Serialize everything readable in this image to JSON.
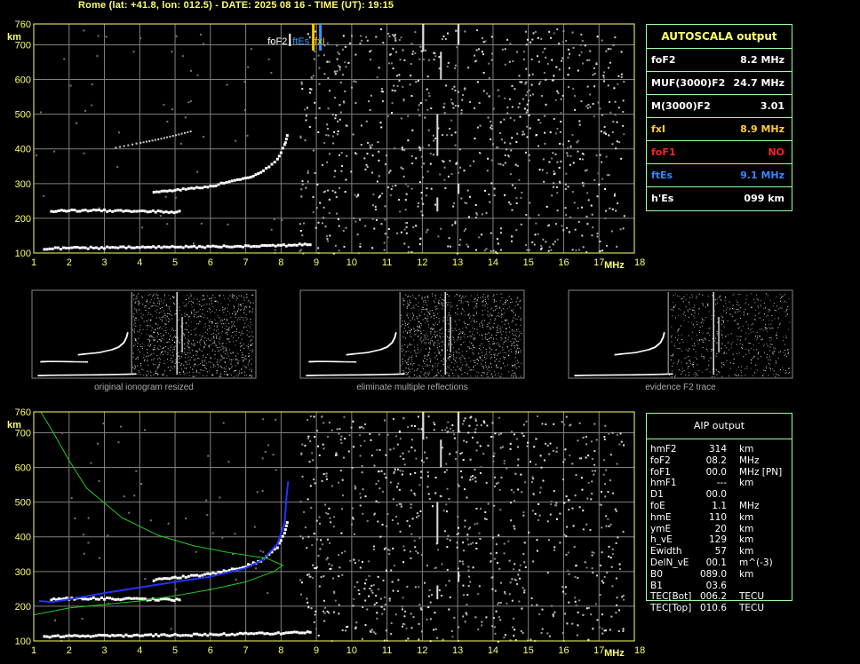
{
  "header": {
    "title": "Rome (lat: +41.8, lon: 012.5) - DATE: 2025 08 16 - TIME (UT): 19:15"
  },
  "colors": {
    "grid": "#808080",
    "axis_text": "#ffff66",
    "trace": "#ffffff",
    "frame": "#99ff99",
    "green_curve": "#22cc22",
    "blue_profile": "#2233ff",
    "fxi_marker": "#ffcc00",
    "ftes_marker": "#3399ff",
    "fof1_red": "#ff2222"
  },
  "autoscala": {
    "title": "AUTOSCALA output",
    "rows": [
      {
        "label": "foF2",
        "value": "8.2 MHz",
        "color": "#ffffff"
      },
      {
        "label": "MUF(3000)F2",
        "value": "24.7 MHz",
        "color": "#ffffff"
      },
      {
        "label": "M(3000)F2",
        "value": "3.01",
        "color": "#ffffff"
      },
      {
        "label": "fxI",
        "value": "8.9 MHz",
        "color": "#ffcc33"
      },
      {
        "label": "foF1",
        "value": "NO",
        "color": "#ff2222"
      },
      {
        "label": "ftEs",
        "value": "9.1 MHz",
        "color": "#3388ff"
      },
      {
        "label": "h'Es",
        "value": "099     km",
        "color": "#ffffff"
      }
    ]
  },
  "aip": {
    "title": "AIP output",
    "rows": [
      {
        "name": "hmF2",
        "value": "314",
        "unit": "km"
      },
      {
        "name": "foF2",
        "value": "08.2",
        "unit": "MHz"
      },
      {
        "name": "foF1",
        "value": "00.0",
        "unit": "MHz   [PN]"
      },
      {
        "name": "hmF1",
        "value": "---",
        "unit": "km"
      },
      {
        "name": "D1",
        "value": "00.0",
        "unit": ""
      },
      {
        "name": "foE",
        "value": "1.1",
        "unit": "MHz"
      },
      {
        "name": "hmE",
        "value": "110",
        "unit": "km"
      },
      {
        "name": "ymE",
        "value": "20",
        "unit": "km"
      },
      {
        "name": "h_vE",
        "value": "129",
        "unit": "km"
      },
      {
        "name": "Ewidth",
        "value": "57",
        "unit": "km"
      },
      {
        "name": "DelN_vE",
        "value": "00.1",
        "unit": "m^(-3)"
      },
      {
        "name": "B0",
        "value": "089.0",
        "unit": "km"
      },
      {
        "name": "B1",
        "value": "03.6",
        "unit": ""
      },
      {
        "name": "TEC[Bot]",
        "value": "006.2",
        "unit": "TECU"
      },
      {
        "name": "TEC[Top]",
        "value": "010.6",
        "unit": "TECU"
      }
    ]
  },
  "captions": [
    "original ionogram resized",
    "eliminate multiple reflections",
    "evidence F2 trace"
  ],
  "markers": {
    "fof2_label": "foF2",
    "ftes_label": "ftEs",
    "fxi_label": "fxI"
  },
  "chart_data": [
    {
      "type": "scatter",
      "title": "",
      "xlabel": "MHz",
      "ylabel": "km",
      "xlim": [
        1,
        18
      ],
      "ylim": [
        100,
        760
      ],
      "xticks": [
        1,
        2,
        3,
        4,
        5,
        6,
        7,
        8,
        9,
        10,
        11,
        12,
        13,
        14,
        15,
        16,
        17,
        18
      ],
      "yticks": [
        100,
        200,
        300,
        400,
        500,
        600,
        700,
        760
      ],
      "grid": true,
      "series": [
        {
          "values": [
            [
              1.3,
              112
            ],
            [
              2,
              114
            ],
            [
              3,
              115
            ],
            [
              4,
              116
            ],
            [
              5,
              117
            ],
            [
              6,
              118
            ],
            [
              7,
              120
            ],
            [
              8,
              122
            ],
            [
              8.9,
              125
            ]
          ]
        },
        {
          "values": [
            [
              1.5,
              220
            ],
            [
              2,
              222
            ],
            [
              3,
              222
            ],
            [
              4,
              220
            ],
            [
              5.2,
              218
            ]
          ]
        },
        {
          "values": [
            [
              4.4,
              275
            ],
            [
              5,
              282
            ],
            [
              6,
              292
            ],
            [
              7,
              315
            ],
            [
              7.5,
              335
            ],
            [
              7.9,
              370
            ],
            [
              8.1,
              410
            ],
            [
              8.2,
              450
            ]
          ]
        },
        {
          "values": [
            [
              3.3,
              406
            ],
            [
              4,
              420
            ],
            [
              4.5,
              430
            ],
            [
              5,
              442
            ],
            [
              5.5,
              455
            ]
          ]
        }
      ],
      "markers": {
        "foF2": 8.2,
        "fxI": 8.9,
        "ftEs": 9.1
      }
    },
    {
      "type": "line",
      "title": "",
      "xlabel": "MHz",
      "ylabel": "km",
      "xlim": [
        1,
        18
      ],
      "ylim": [
        100,
        760
      ],
      "xticks": [
        1,
        2,
        3,
        4,
        5,
        6,
        7,
        8,
        9,
        10,
        11,
        12,
        13,
        14,
        15,
        16,
        17,
        18
      ],
      "yticks": [
        100,
        200,
        300,
        400,
        500,
        600,
        700,
        760
      ],
      "grid": true,
      "series": [
        {
          "values": [
            [
              1.3,
              112
            ],
            [
              2,
              114
            ],
            [
              3,
              115
            ],
            [
              4,
              116
            ],
            [
              5,
              117
            ],
            [
              6,
              118
            ],
            [
              7,
              120
            ],
            [
              8,
              122
            ],
            [
              8.9,
              125
            ]
          ]
        },
        {
          "values": [
            [
              1.5,
              220
            ],
            [
              2,
              222
            ],
            [
              3,
              222
            ],
            [
              4,
              220
            ],
            [
              5.2,
              218
            ]
          ]
        },
        {
          "values": [
            [
              4.4,
              275
            ],
            [
              5,
              282
            ],
            [
              6,
              292
            ],
            [
              7,
              315
            ],
            [
              7.5,
              335
            ],
            [
              7.9,
              370
            ],
            [
              8.1,
              410
            ],
            [
              8.2,
              450
            ]
          ]
        },
        {
          "values": [
            [
              1.15,
              215
            ],
            [
              1.5,
              212
            ],
            [
              2,
              220
            ],
            [
              3,
              238
            ],
            [
              4,
              254
            ],
            [
              5,
              270
            ],
            [
              6,
              285
            ],
            [
              7,
              310
            ],
            [
              7.5,
              335
            ],
            [
              7.9,
              380
            ],
            [
              8.1,
              440
            ],
            [
              8.15,
              510
            ],
            [
              8.2,
              560
            ]
          ]
        },
        {
          "values": [
            [
              1,
              105
            ],
            [
              1,
              175
            ],
            [
              2,
              195
            ],
            [
              3,
              205
            ],
            [
              4,
              215
            ],
            [
              5,
              230
            ],
            [
              6,
              248
            ],
            [
              7,
              270
            ],
            [
              7.8,
              300
            ],
            [
              8.05,
              318
            ],
            [
              7.6,
              338
            ],
            [
              6.5,
              355
            ],
            [
              5.5,
              375
            ],
            [
              4.5,
              405
            ],
            [
              3.5,
              455
            ],
            [
              2.5,
              540
            ],
            [
              2,
              620
            ],
            [
              1.5,
              710
            ],
            [
              1.2,
              760
            ]
          ]
        }
      ]
    }
  ]
}
